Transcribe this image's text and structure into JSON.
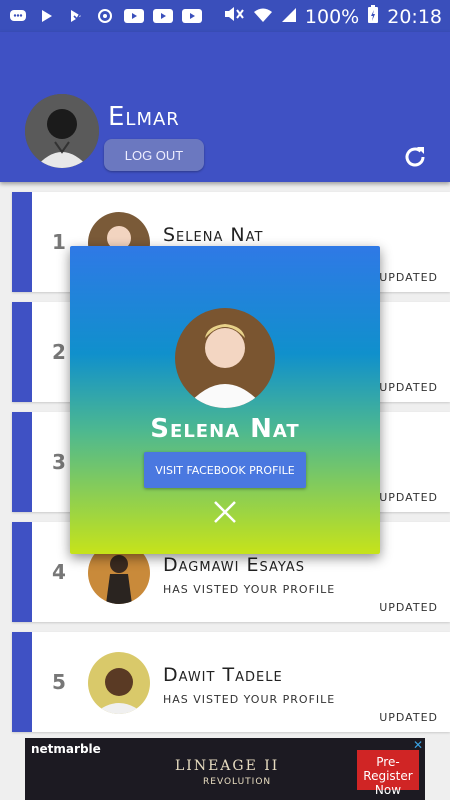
{
  "status_bar": {
    "battery": "100%",
    "time": "20:18",
    "icons": [
      "chat-icon",
      "play-store-icon",
      "play-store-icon",
      "sync-icon",
      "youtube-icon",
      "youtube-icon",
      "youtube-icon",
      "mute-icon",
      "wifi-icon",
      "signal-icon",
      "battery-charging-icon"
    ]
  },
  "header": {
    "username": "Elmar",
    "logout_label": "LOG OUT",
    "accent": "#3f51c4"
  },
  "list": [
    {
      "rank": "1",
      "name": "Selena Nat",
      "sub": "",
      "updated": "UPDATED"
    },
    {
      "rank": "2",
      "name": "",
      "sub": "",
      "updated": "UPDATED"
    },
    {
      "rank": "3",
      "name": "",
      "sub": "",
      "updated": "UPDATED"
    },
    {
      "rank": "4",
      "name": "Dagmawi Esayas",
      "sub": "HAS VISTED YOUR PROFILE",
      "updated": "UPDATED"
    },
    {
      "rank": "5",
      "name": "Dawit Tadele",
      "sub": "HAS VISTED YOUR PROFILE",
      "updated": "UPDATED"
    }
  ],
  "popup": {
    "name": "Selena Nat",
    "button_label": "VISIT FACEBOOK PROFILE"
  },
  "ad": {
    "brand": "netmarble",
    "title": "LINEAGE II",
    "subtitle": "REVOLUTION",
    "cta": "Pre-Register Now"
  }
}
